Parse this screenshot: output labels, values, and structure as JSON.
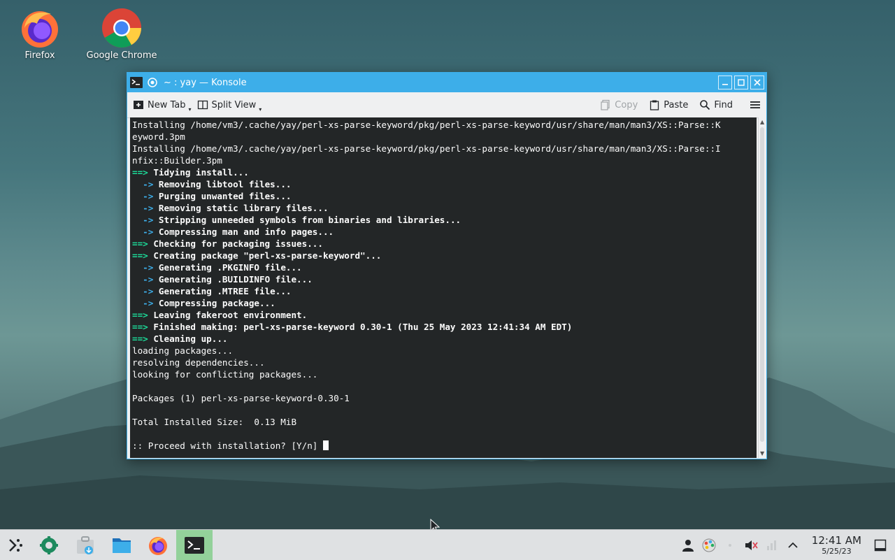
{
  "desktop": {
    "icons": [
      {
        "label": "Firefox",
        "icon": "firefox-icon"
      },
      {
        "label": "Google Chrome",
        "icon": "chrome-icon"
      }
    ]
  },
  "window": {
    "title": "~ : yay — Konsole",
    "toolbar": {
      "new_tab": "New Tab",
      "split_view": "Split View",
      "copy": "Copy",
      "paste": "Paste",
      "find": "Find"
    }
  },
  "terminal": {
    "lines": [
      {
        "type": "plain",
        "text": "Installing /home/vm3/.cache/yay/perl-xs-parse-keyword/pkg/perl-xs-parse-keyword/usr/share/man/man3/XS::Parse::K"
      },
      {
        "type": "plain",
        "text": "eyword.3pm"
      },
      {
        "type": "plain",
        "text": "Installing /home/vm3/.cache/yay/perl-xs-parse-keyword/pkg/perl-xs-parse-keyword/usr/share/man/man3/XS::Parse::I"
      },
      {
        "type": "plain",
        "text": "nfix::Builder.3pm"
      },
      {
        "type": "major",
        "marker": "==>",
        "text": " Tidying install..."
      },
      {
        "type": "minor",
        "marker": "  ->",
        "text": " Removing libtool files..."
      },
      {
        "type": "minor",
        "marker": "  ->",
        "text": " Purging unwanted files..."
      },
      {
        "type": "minor",
        "marker": "  ->",
        "text": " Removing static library files..."
      },
      {
        "type": "minor",
        "marker": "  ->",
        "text": " Stripping unneeded symbols from binaries and libraries..."
      },
      {
        "type": "minor",
        "marker": "  ->",
        "text": " Compressing man and info pages..."
      },
      {
        "type": "major",
        "marker": "==>",
        "text": " Checking for packaging issues..."
      },
      {
        "type": "major",
        "marker": "==>",
        "text": " Creating package \"perl-xs-parse-keyword\"..."
      },
      {
        "type": "minor",
        "marker": "  ->",
        "text": " Generating .PKGINFO file..."
      },
      {
        "type": "minor",
        "marker": "  ->",
        "text": " Generating .BUILDINFO file..."
      },
      {
        "type": "minor",
        "marker": "  ->",
        "text": " Generating .MTREE file..."
      },
      {
        "type": "minor",
        "marker": "  ->",
        "text": " Compressing package..."
      },
      {
        "type": "major",
        "marker": "==>",
        "text": " Leaving fakeroot environment."
      },
      {
        "type": "major",
        "marker": "==>",
        "text": " Finished making: perl-xs-parse-keyword 0.30-1 (Thu 25 May 2023 12:41:34 AM EDT)"
      },
      {
        "type": "major",
        "marker": "==>",
        "text": " Cleaning up..."
      },
      {
        "type": "plain",
        "text": "loading packages..."
      },
      {
        "type": "plain",
        "text": "resolving dependencies..."
      },
      {
        "type": "plain",
        "text": "looking for conflicting packages..."
      },
      {
        "type": "plain",
        "text": ""
      },
      {
        "type": "plain",
        "text": "Packages (1) perl-xs-parse-keyword-0.30-1"
      },
      {
        "type": "plain",
        "text": ""
      },
      {
        "type": "plain",
        "text": "Total Installed Size:  0.13 MiB"
      },
      {
        "type": "plain",
        "text": ""
      }
    ],
    "prompt": ":: Proceed with installation? [Y/n] "
  },
  "taskbar": {
    "clock_time": "12:41 AM",
    "clock_date": "5/25/23"
  },
  "colors": {
    "accent": "#3daee9",
    "terminal_bg": "#232627",
    "marker_green": "#1cdc9a",
    "marker_blue": "#3daee9",
    "taskbar_active": "#93d19a"
  }
}
